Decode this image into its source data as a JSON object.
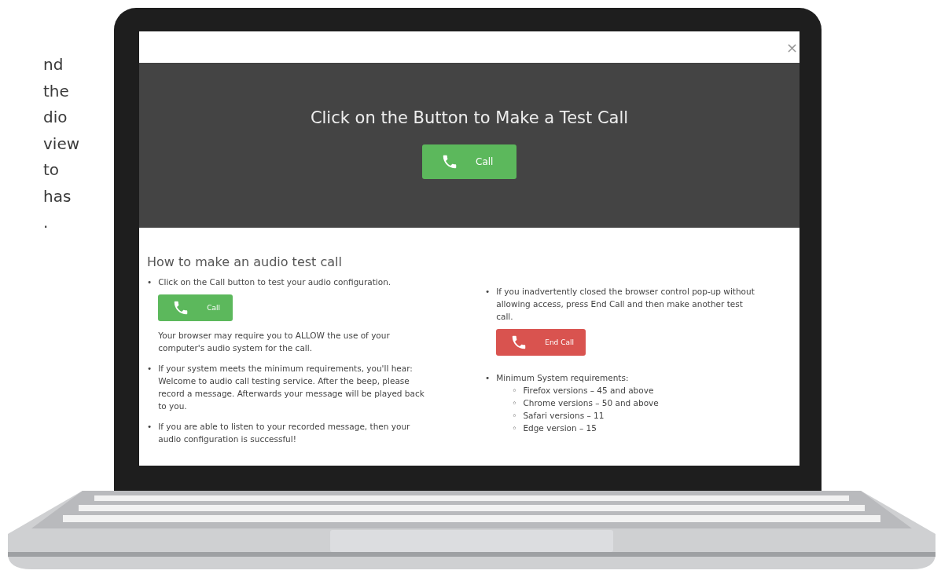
{
  "side_text_lines": [
    "nd",
    "the",
    "dio",
    "view",
    "to",
    "has",
    "."
  ],
  "dialog": {
    "close": "×",
    "banner": {
      "title": "Click on the Button to Make a Test Call",
      "button": {
        "label": "Call",
        "kind": "call"
      }
    },
    "section": {
      "heading": "How to make an audio test call",
      "columns": [
        [
          {
            "bullet": "•",
            "text": "Click on the Call button to test your audio configuration.",
            "button": {
              "label": "Call",
              "kind": "call"
            },
            "note": "Your browser may require you to ALLOW the use of your computer's audio system for the call."
          },
          {
            "bullet": "•",
            "text": "If your system meets the minimum requirements, you'll hear: Welcome to audio call testing service. After the beep, please record a message. Afterwards your message will be played back to you."
          },
          {
            "bullet": "•",
            "text": "If you are able to listen to your recorded message, then your audio configuration is successful!"
          }
        ],
        [
          {
            "bullet": "•",
            "text": "If you inadvertently closed the browser control pop-up without allowing access, press End Call and then make another test call.",
            "button": {
              "label": "End Call",
              "kind": "end"
            }
          },
          {
            "bullet": "•",
            "text": "Minimum System requirements:",
            "subitems": [
              {
                "bullet": "◦",
                "text": "Firefox versions – 45 and above"
              },
              {
                "bullet": "◦",
                "text": "Chrome versions – 50 and above"
              },
              {
                "bullet": "◦",
                "text": "Safari versions – 11"
              },
              {
                "bullet": "◦",
                "text": "Edge version – 15"
              }
            ]
          }
        ]
      ]
    }
  }
}
